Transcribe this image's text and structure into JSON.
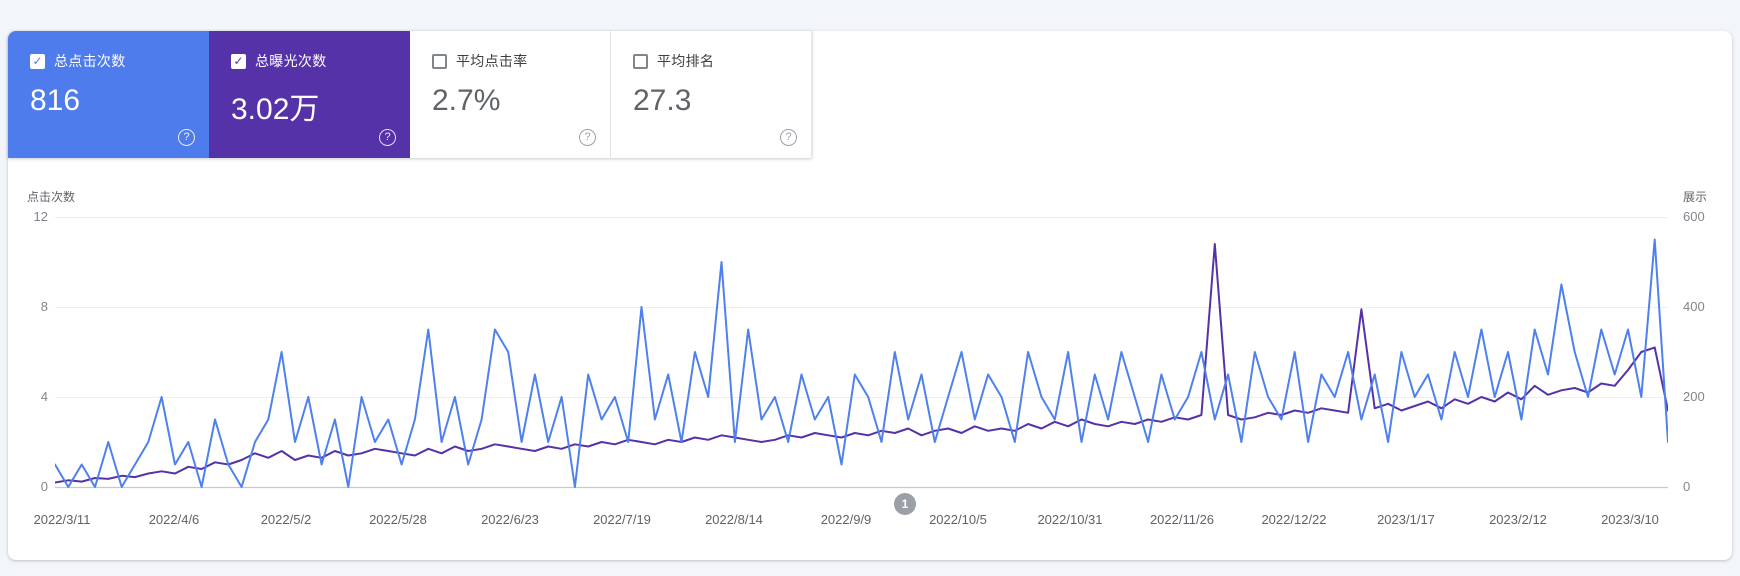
{
  "colors": {
    "clicks_accent": "#4e7cec",
    "impressions_accent": "#5632a8",
    "gridline": "#eceef1",
    "baseline": "#c6cace",
    "badge_gray": "#9aa0a6"
  },
  "icons": {
    "check": "✓",
    "help": "?"
  },
  "tiles": [
    {
      "label": "总点击次数",
      "value": "816",
      "checked": true,
      "bg": "#4e7cec"
    },
    {
      "label": "总曝光次数",
      "value": "3.02万",
      "checked": true,
      "bg": "#5632a8"
    },
    {
      "label": "平均点击率",
      "value": "2.7%",
      "checked": false,
      "bg": ""
    },
    {
      "label": "平均排名",
      "value": "27.3",
      "checked": false,
      "bg": ""
    }
  ],
  "chart_data": {
    "type": "line",
    "title": "",
    "x_start": "2022/3/11",
    "x_end": "2023/3/10",
    "x_tick_labels": [
      "2022/3/11",
      "2022/4/6",
      "2022/5/2",
      "2022/5/28",
      "2022/6/23",
      "2022/7/19",
      "2022/8/14",
      "2022/9/9",
      "2022/10/5",
      "2022/10/31",
      "2022/11/26",
      "2022/12/22",
      "2023/1/17",
      "2023/2/12",
      "2023/3/10"
    ],
    "left_axis": {
      "title": "点击次数",
      "ticks": [
        12,
        8,
        4,
        0
      ],
      "range": [
        0,
        12
      ]
    },
    "right_axis": {
      "title": "展示",
      "ticks": [
        600,
        400,
        200,
        0
      ],
      "range": [
        0,
        600
      ]
    },
    "grid": true,
    "legend": "none",
    "annotation_badge": "1",
    "estimation_note": "daily series sampled every ~3 days, values estimated from pixels",
    "series": [
      {
        "name": "点击次数",
        "axis": "left",
        "color": "#4e80ee",
        "values": [
          1,
          0,
          1,
          0,
          2,
          0,
          1,
          2,
          4,
          1,
          2,
          0,
          3,
          1,
          0,
          2,
          3,
          6,
          2,
          4,
          1,
          3,
          0,
          4,
          2,
          3,
          1,
          3,
          7,
          2,
          4,
          1,
          3,
          7,
          6,
          2,
          5,
          2,
          4,
          0,
          5,
          3,
          4,
          2,
          8,
          3,
          5,
          2,
          6,
          4,
          10,
          2,
          7,
          3,
          4,
          2,
          5,
          3,
          4,
          1,
          5,
          4,
          2,
          6,
          3,
          5,
          2,
          4,
          6,
          3,
          5,
          4,
          2,
          6,
          4,
          3,
          6,
          2,
          5,
          3,
          6,
          4,
          2,
          5,
          3,
          4,
          6,
          3,
          5,
          2,
          6,
          4,
          3,
          6,
          2,
          5,
          4,
          6,
          3,
          5,
          2,
          6,
          4,
          5,
          3,
          6,
          4,
          7,
          4,
          6,
          3,
          7,
          5,
          9,
          6,
          4,
          7,
          5,
          7,
          4,
          11,
          2
        ]
      },
      {
        "name": "曝光次数",
        "axis": "right",
        "color": "#5632a8",
        "values": [
          10,
          15,
          12,
          20,
          18,
          25,
          22,
          30,
          35,
          30,
          45,
          40,
          55,
          50,
          60,
          75,
          65,
          80,
          60,
          70,
          65,
          80,
          70,
          75,
          85,
          80,
          75,
          70,
          85,
          75,
          90,
          80,
          85,
          95,
          90,
          85,
          80,
          90,
          85,
          95,
          90,
          100,
          95,
          105,
          100,
          95,
          105,
          100,
          110,
          105,
          115,
          110,
          105,
          100,
          105,
          115,
          110,
          120,
          115,
          110,
          120,
          115,
          125,
          120,
          130,
          115,
          125,
          130,
          120,
          135,
          125,
          130,
          125,
          140,
          130,
          145,
          135,
          150,
          140,
          135,
          145,
          140,
          150,
          145,
          155,
          150,
          160,
          540,
          160,
          150,
          155,
          165,
          160,
          170,
          165,
          175,
          170,
          165,
          395,
          175,
          185,
          170,
          180,
          190,
          175,
          195,
          185,
          200,
          190,
          210,
          195,
          225,
          205,
          215,
          220,
          210,
          230,
          225,
          260,
          300,
          310,
          170
        ]
      }
    ]
  }
}
